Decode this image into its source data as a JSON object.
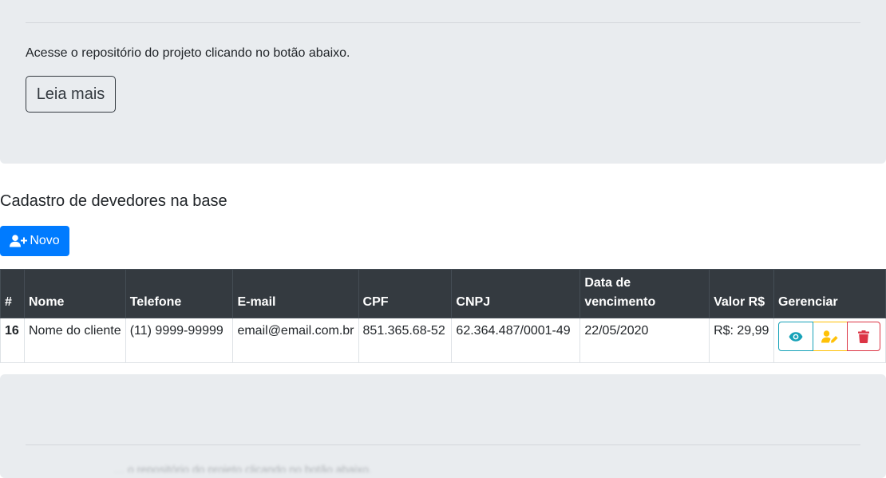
{
  "top_section": {
    "lead": "Acesse o repositório do projeto clicando no botão abaixo.",
    "read_more_label": "Leia mais"
  },
  "debtors": {
    "title": "Cadastro de devedores na base",
    "new_button_label": "Novo",
    "columns": [
      "#",
      "Nome",
      "Telefone",
      "E-mail",
      "CPF",
      "CNPJ",
      "Data de vencimento",
      "Valor R$",
      "Gerenciar"
    ],
    "rows": [
      {
        "id": "16",
        "name": "Nome do cliente",
        "phone": "(11) 9999-99999",
        "email": "email@email.com.br",
        "cpf": "851.365.68-52",
        "cnpj": "62.364.487/0001-49",
        "due_date": "22/05/2020",
        "amount": "R$: 29,99"
      }
    ]
  },
  "bottom_section": {
    "faded_text": "… o repositório do projeto clicando no botão abaixo."
  },
  "colors": {
    "primary": "#007bff",
    "dark": "#343a40",
    "info": "#17a2b8",
    "warning": "#ffc107",
    "danger": "#dc3545",
    "jumbotron_bg": "#e9ecef"
  },
  "icons": {
    "new": "user-plus-icon",
    "view": "eye-icon",
    "edit": "user-edit-icon",
    "delete": "trash-icon"
  }
}
